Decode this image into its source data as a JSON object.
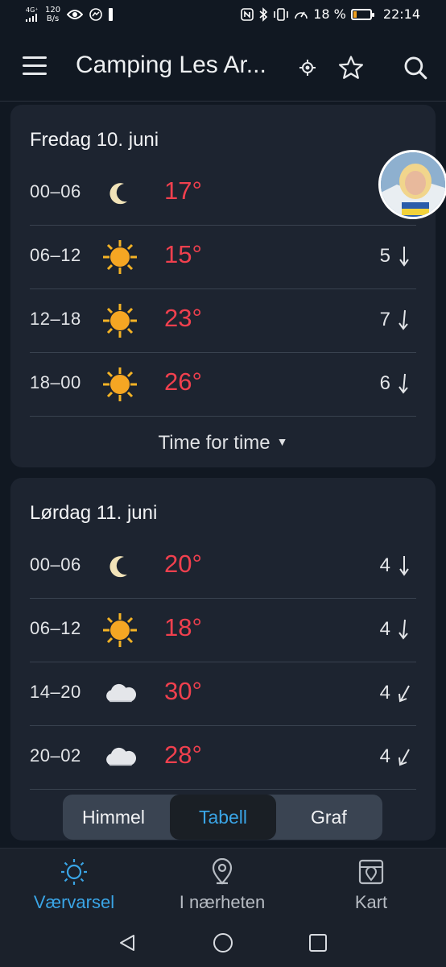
{
  "status_bar": {
    "network": "4G⁺",
    "speed_value": "120",
    "speed_unit": "B/s",
    "battery": "18 %",
    "battery_level_fraction": 0.18,
    "time": "22:14"
  },
  "app_bar": {
    "title": "Camping Les Ar...",
    "icons": [
      "menu-icon",
      "location-icon",
      "star-icon",
      "search-icon"
    ]
  },
  "days": [
    {
      "title": "Fredag 10. juni",
      "rows": [
        {
          "time": "00–06",
          "icon": "moon",
          "temp": "17°",
          "wind": "",
          "wind_dir": ""
        },
        {
          "time": "06–12",
          "icon": "sun",
          "temp": "15°",
          "wind": "5",
          "wind_dir": "south"
        },
        {
          "time": "12–18",
          "icon": "sun",
          "temp": "23°",
          "wind": "7",
          "wind_dir": "south"
        },
        {
          "time": "18–00",
          "icon": "sun",
          "temp": "26°",
          "wind": "6",
          "wind_dir": "south"
        }
      ],
      "more_label": "Time for time"
    },
    {
      "title": "Lørdag 11. juni",
      "rows": [
        {
          "time": "00–06",
          "icon": "moon",
          "temp": "20°",
          "wind": "4",
          "wind_dir": "south"
        },
        {
          "time": "06–12",
          "icon": "sun",
          "temp": "18°",
          "wind": "4",
          "wind_dir": "south"
        },
        {
          "time": "14–20",
          "icon": "cloud",
          "temp": "30°",
          "wind": "4",
          "wind_dir": "southwest"
        },
        {
          "time": "20–02",
          "icon": "cloud",
          "temp": "28°",
          "wind": "4",
          "wind_dir": "southwest"
        }
      ]
    }
  ],
  "view_toggle": {
    "options": [
      "Himmel",
      "Tabell",
      "Graf"
    ],
    "selected": "Tabell"
  },
  "bottom_nav": [
    {
      "label": "Værvarsel",
      "icon": "sun-outline-icon",
      "active": true
    },
    {
      "label": "I nærheten",
      "icon": "pin-icon",
      "active": false
    },
    {
      "label": "Kart",
      "icon": "map-icon",
      "active": false
    }
  ],
  "colors": {
    "background": "#111822",
    "card": "#1d2430",
    "temp_warm": "#f0404e",
    "accent": "#3aa5e6"
  }
}
